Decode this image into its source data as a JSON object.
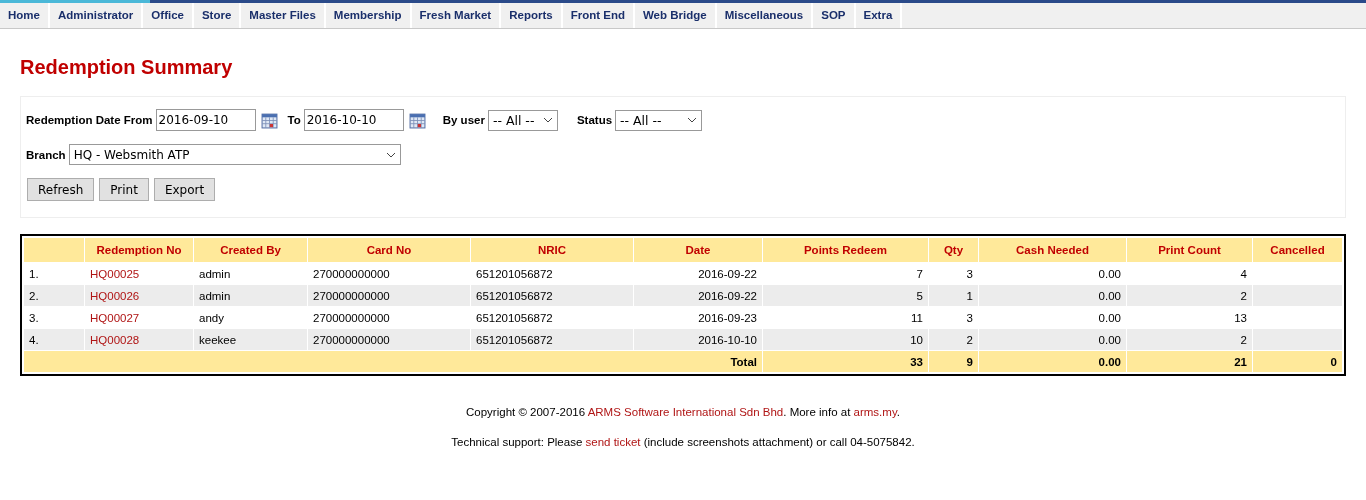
{
  "menu": [
    "Home",
    "Administrator",
    "Office",
    "Store",
    "Master Files",
    "Membership",
    "Fresh Market",
    "Reports",
    "Front End",
    "Web Bridge",
    "Miscellaneous",
    "SOP",
    "Extra"
  ],
  "page_title": "Redemption Summary",
  "filters": {
    "date_from_label": "Redemption Date From",
    "date_from": "2016-09-10",
    "date_to_label": "To",
    "date_to": "2016-10-10",
    "user_label": "By user",
    "user": "-- All --",
    "status_label": "Status",
    "status": "-- All --",
    "branch_label": "Branch",
    "branch": "HQ - Websmith ATP"
  },
  "buttons": [
    "Refresh",
    "Print",
    "Export"
  ],
  "table": {
    "columns": [
      "",
      "Redemption No",
      "Created By",
      "Card No",
      "NRIC",
      "Date",
      "Points Redeem",
      "Qty",
      "Cash Needed",
      "Print Count",
      "Cancelled"
    ],
    "rows": [
      [
        "1.",
        "HQ00025",
        "admin",
        "270000000000",
        "651201056872",
        "2016-09-22",
        "7",
        "3",
        "0.00",
        "4",
        ""
      ],
      [
        "2.",
        "HQ00026",
        "admin",
        "270000000000",
        "651201056872",
        "2016-09-22",
        "5",
        "1",
        "0.00",
        "2",
        ""
      ],
      [
        "3.",
        "HQ00027",
        "andy",
        "270000000000",
        "651201056872",
        "2016-09-23",
        "11",
        "3",
        "0.00",
        "13",
        ""
      ],
      [
        "4.",
        "HQ00028",
        "keekee",
        "270000000000",
        "651201056872",
        "2016-10-10",
        "10",
        "2",
        "0.00",
        "2",
        ""
      ]
    ],
    "total": {
      "label": "Total",
      "values": [
        "33",
        "9",
        "0.00",
        "21",
        "0"
      ]
    }
  },
  "footer": [
    [
      {
        "kind": "text",
        "text": "Copyright © 2007-2016 "
      },
      {
        "kind": "link",
        "text": "ARMS Software International Sdn Bhd"
      },
      {
        "kind": "text",
        "text": ". More info at "
      },
      {
        "kind": "link",
        "text": "arms.my"
      },
      {
        "kind": "text",
        "text": "."
      }
    ],
    [
      {
        "kind": "text",
        "text": "Technical support: Please "
      },
      {
        "kind": "link",
        "text": "send ticket"
      },
      {
        "kind": "text",
        "text": " (include screenshots attachment) or call 04-5075842."
      }
    ]
  ]
}
